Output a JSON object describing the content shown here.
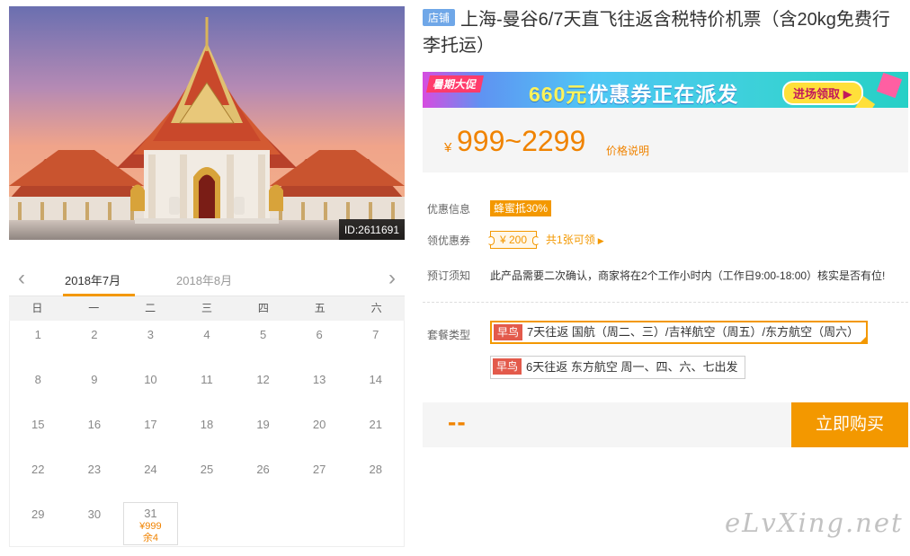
{
  "product": {
    "image_id": "ID:2611691",
    "store_badge": "店铺",
    "title": "上海-曼谷6/7天直飞往返含税特价机票（含20kg免费行李托运）"
  },
  "calendar": {
    "prev_icon": "chevron-left-icon",
    "next_icon": "chevron-right-icon",
    "months": [
      "2018年7月",
      "2018年8月"
    ],
    "active_month_index": 0,
    "weekdays": [
      "日",
      "一",
      "二",
      "三",
      "四",
      "五",
      "六"
    ],
    "days": [
      {
        "day": "1"
      },
      {
        "day": "2"
      },
      {
        "day": "3"
      },
      {
        "day": "4"
      },
      {
        "day": "5"
      },
      {
        "day": "6"
      },
      {
        "day": "7"
      },
      {
        "day": "8"
      },
      {
        "day": "9"
      },
      {
        "day": "10"
      },
      {
        "day": "11"
      },
      {
        "day": "12"
      },
      {
        "day": "13"
      },
      {
        "day": "14"
      },
      {
        "day": "15"
      },
      {
        "day": "16"
      },
      {
        "day": "17"
      },
      {
        "day": "18"
      },
      {
        "day": "19"
      },
      {
        "day": "20"
      },
      {
        "day": "21"
      },
      {
        "day": "22"
      },
      {
        "day": "23"
      },
      {
        "day": "24"
      },
      {
        "day": "25"
      },
      {
        "day": "26"
      },
      {
        "day": "27"
      },
      {
        "day": "28"
      },
      {
        "day": "29"
      },
      {
        "day": "30"
      },
      {
        "day": "31",
        "price": "¥999",
        "remaining": "余4"
      }
    ]
  },
  "banner": {
    "tag": "暑期大促",
    "amount": "660元",
    "text": "优惠券正在派发",
    "cta": "进场领取 ▶"
  },
  "price": {
    "currency": "¥",
    "range": "999~2299",
    "note": "价格说明"
  },
  "info": {
    "discount_label": "优惠信息",
    "discount_value": "蜂蜜抵30%",
    "coupon_label": "领优惠券",
    "coupon_value": "¥ 200",
    "coupon_count": "共1张可领",
    "notice_label": "预订须知",
    "notice_value": "此产品需要二次确认，商家将在2个工作小时内（工作日9:00-18:00）核实是否有位!"
  },
  "packages": {
    "label": "套餐类型",
    "items": [
      {
        "tag": "早鸟",
        "text": "7天往返 国航（周二、三）/吉祥航空（周五）/东方航空（周六）",
        "selected": true
      },
      {
        "tag": "早鸟",
        "text": "6天往返 东方航空 周一、四、六、七出发",
        "selected": false
      }
    ]
  },
  "purchase": {
    "total": "--",
    "buy_label": "立即购买"
  },
  "watermark": "eLvXing.net",
  "colors": {
    "accent": "#f39800",
    "price": "#f08300",
    "store_badge": "#6fa7e8",
    "early_bird": "#e35a4b"
  }
}
